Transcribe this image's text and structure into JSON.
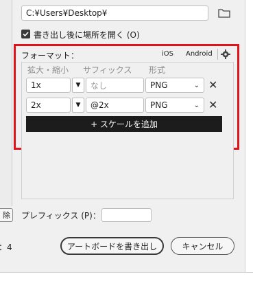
{
  "path_field": {
    "value": "C:¥Users¥Desktop¥"
  },
  "open_location": {
    "label": "書き出し後に場所を開く (O)",
    "checked": true
  },
  "format": {
    "label": "フォーマット：",
    "ios_label": "iOS",
    "android_label": "Android",
    "headers": {
      "scale": "拡大・縮小",
      "suffix": "サフィックス",
      "type": "形式"
    },
    "rows": [
      {
        "scale": "1x",
        "suffix": "",
        "suffix_placeholder": "なし",
        "type": "PNG"
      },
      {
        "scale": "2x",
        "suffix": "@2x",
        "suffix_placeholder": "",
        "type": "PNG"
      }
    ],
    "add_scale_label": "+ スケールを追加"
  },
  "left_clip_button": "除",
  "prefix": {
    "label": "プレフィックス (P)：",
    "value": ""
  },
  "count_text": "：4",
  "export_button": "アートボードを書き出し",
  "cancel_button": "キャンセル",
  "colors": {
    "highlight": "#e0131a",
    "add_button_bg": "#1c1c1c"
  }
}
